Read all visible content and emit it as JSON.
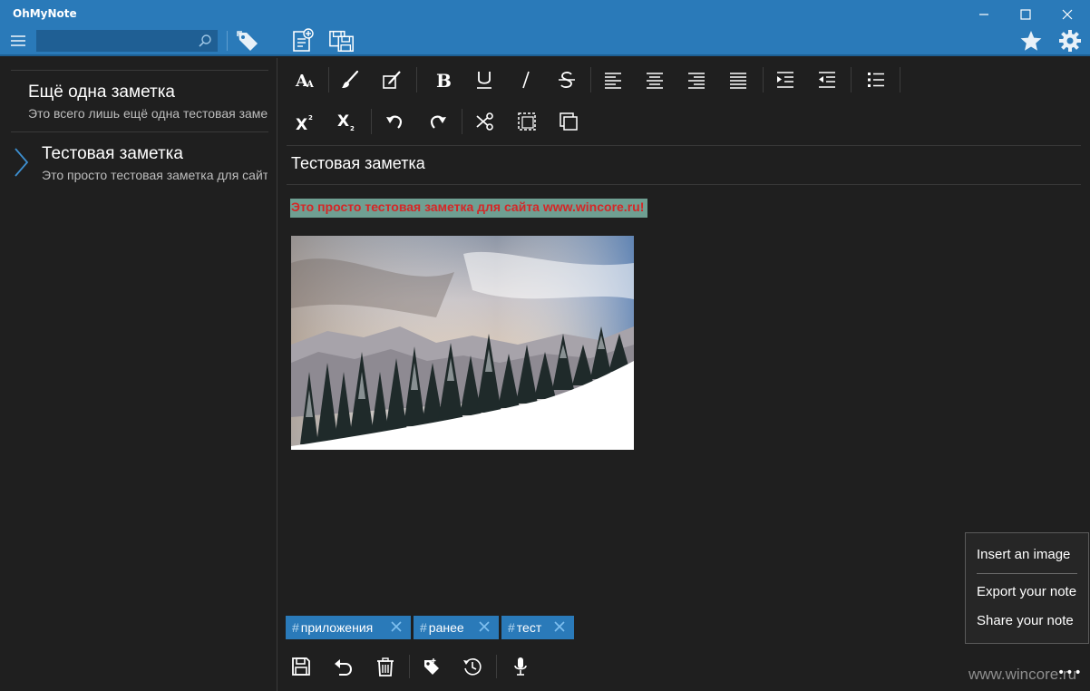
{
  "window": {
    "title": "OhMyNote"
  },
  "search": {
    "placeholder": "",
    "value": ""
  },
  "notes": [
    {
      "title": "Ещё одна заметка",
      "preview": "Это всего лишь ещё одна тестовая заметка"
    },
    {
      "title": "Тестовая заметка",
      "preview": "Это просто тестовая заметка для сайта www.wincore.ru!",
      "selected": true
    }
  ],
  "editor": {
    "heading": "Тестовая заметка",
    "highlighted_text": "Это просто тестовая заметка для сайта www.wincore.ru!",
    "highlight_color": "#6f9f92",
    "text_color": "#d42727"
  },
  "tags": [
    {
      "label": "приложения"
    },
    {
      "label": "ранее"
    },
    {
      "label": "тест"
    }
  ],
  "tag_prefix": "#",
  "context_menu": {
    "items": [
      "Insert an image",
      "Export your note",
      "Share your note"
    ]
  },
  "more_label": "•••",
  "watermark": "www.wincore.ru",
  "colors": {
    "accent": "#2a7ab9",
    "background": "#1f1f1f"
  }
}
